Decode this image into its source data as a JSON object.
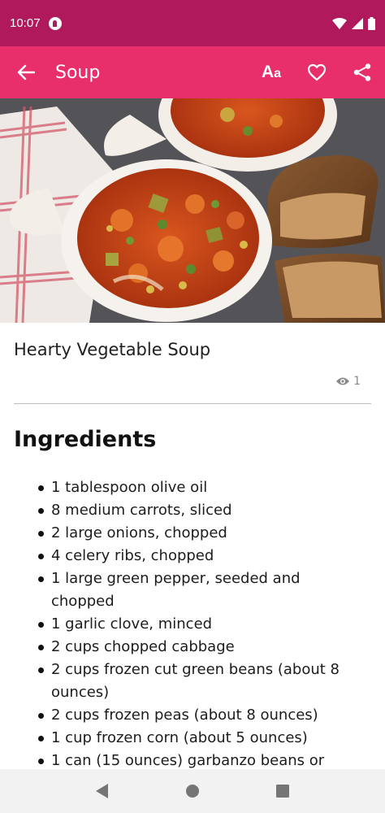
{
  "status_bar": {
    "time": "10:07"
  },
  "app_bar": {
    "title": "Soup",
    "font_button": {
      "big": "A",
      "small": "a"
    }
  },
  "recipe": {
    "title": "Hearty Vegetable Soup",
    "views": "1",
    "section_heading": "Ingredients",
    "ingredients": [
      "1 tablespoon olive oil",
      "8 medium carrots, sliced",
      "2 large onions, chopped",
      "4 celery ribs, chopped",
      "1 large green pepper, seeded and chopped",
      "1 garlic clove, minced",
      "2 cups chopped cabbage",
      "2 cups frozen cut green beans (about 8 ounces)",
      "2 cups frozen peas (about 8 ounces)",
      "1 cup frozen corn (about 5 ounces)",
      "1 can (15 ounces) garbanzo beans or"
    ]
  },
  "colors": {
    "status_bar": "#b01a5c",
    "app_bar": "#e92e6c",
    "text": "#212121",
    "muted": "#8a8a8a"
  },
  "icons": [
    "app-notification-icon",
    "wifi-icon",
    "signal-icon",
    "battery-icon",
    "back-arrow-icon",
    "font-size-icon",
    "heart-icon",
    "share-icon",
    "eye-icon",
    "nav-back-icon",
    "nav-home-icon",
    "nav-recents-icon"
  ]
}
